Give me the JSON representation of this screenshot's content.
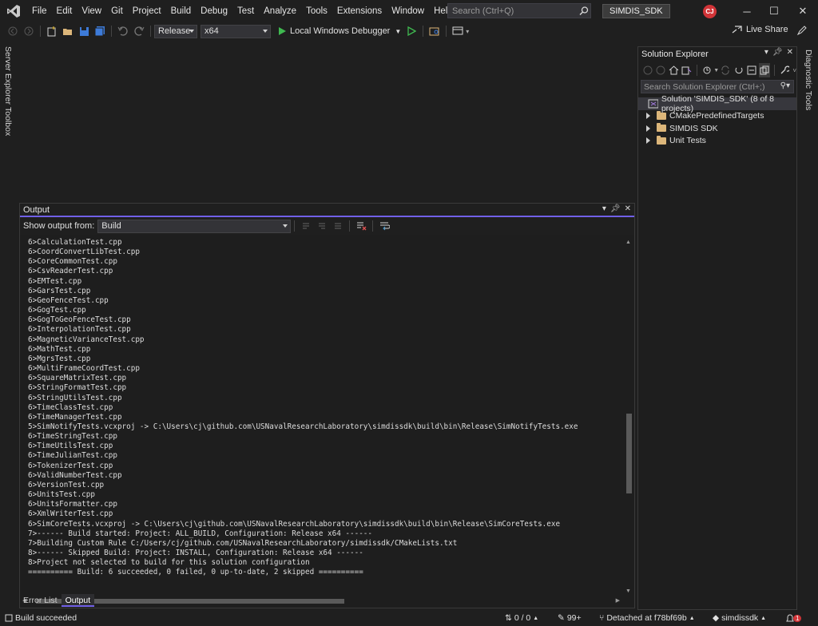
{
  "menu": [
    "File",
    "Edit",
    "View",
    "Git",
    "Project",
    "Build",
    "Debug",
    "Test",
    "Analyze",
    "Tools",
    "Extensions",
    "Window",
    "Help"
  ],
  "search": {
    "placeholder": "Search (Ctrl+Q)"
  },
  "project_name": "SIMDIS_SDK",
  "user_initials": "CJ",
  "toolbar": {
    "configuration": "Release",
    "platform": "x64",
    "run_label": "Local Windows Debugger",
    "live_share": "Live Share"
  },
  "left_tabs": [
    "Server Explorer",
    "Toolbox"
  ],
  "right_tabs": [
    "Diagnostic Tools"
  ],
  "output": {
    "title": "Output",
    "show_from_label": "Show output from:",
    "source": "Build",
    "lines": [
      "6>CalculationTest.cpp",
      "6>CoordConvertLibTest.cpp",
      "6>CoreCommonTest.cpp",
      "6>CsvReaderTest.cpp",
      "6>EMTest.cpp",
      "6>GarsTest.cpp",
      "6>GeoFenceTest.cpp",
      "6>GogTest.cpp",
      "6>GogToGeoFenceTest.cpp",
      "6>InterpolationTest.cpp",
      "6>MagneticVarianceTest.cpp",
      "6>MathTest.cpp",
      "6>MgrsTest.cpp",
      "6>MultiFrameCoordTest.cpp",
      "6>SquareMatrixTest.cpp",
      "6>StringFormatTest.cpp",
      "6>StringUtilsTest.cpp",
      "6>TimeClassTest.cpp",
      "6>TimeManagerTest.cpp",
      "5>SimNotifyTests.vcxproj -> C:\\Users\\cj\\github.com\\USNavalResearchLaboratory\\simdissdk\\build\\bin\\Release\\SimNotifyTests.exe",
      "6>TimeStringTest.cpp",
      "6>TimeUtilsTest.cpp",
      "6>TimeJulianTest.cpp",
      "6>TokenizerTest.cpp",
      "6>ValidNumberTest.cpp",
      "6>VersionTest.cpp",
      "6>UnitsTest.cpp",
      "6>UnitsFormatter.cpp",
      "6>XmlWriterTest.cpp",
      "6>SimCoreTests.vcxproj -> C:\\Users\\cj\\github.com\\USNavalResearchLaboratory\\simdissdk\\build\\bin\\Release\\SimCoreTests.exe",
      "7>------ Build started: Project: ALL_BUILD, Configuration: Release x64 ------",
      "7>Building Custom Rule C:/Users/cj/github.com/USNavalResearchLaboratory/simdissdk/CMakeLists.txt",
      "8>------ Skipped Build: Project: INSTALL, Configuration: Release x64 ------",
      "8>Project not selected to build for this solution configuration",
      "========== Build: 6 succeeded, 0 failed, 0 up-to-date, 2 skipped =========="
    ]
  },
  "bottom_tabs": [
    "Error List",
    "Output"
  ],
  "solution_explorer": {
    "title": "Solution Explorer",
    "search_placeholder": "Search Solution Explorer (Ctrl+;)",
    "solution_label": "Solution 'SIMDIS_SDK' (8 of 8 projects)",
    "items": [
      "CMakePredefinedTargets",
      "SIMDIS SDK",
      "Unit Tests"
    ]
  },
  "statusbar": {
    "message": "Build succeeded",
    "changes": "0 / 0",
    "edits": "99+",
    "branch": "Detached at f78bf69b",
    "repo": "simdissdk",
    "notifications": "1"
  },
  "colors": {
    "accent": "#7160e8",
    "background": "#1f1f1f",
    "avatar": "#d13438",
    "folder": "#dcb67a"
  }
}
